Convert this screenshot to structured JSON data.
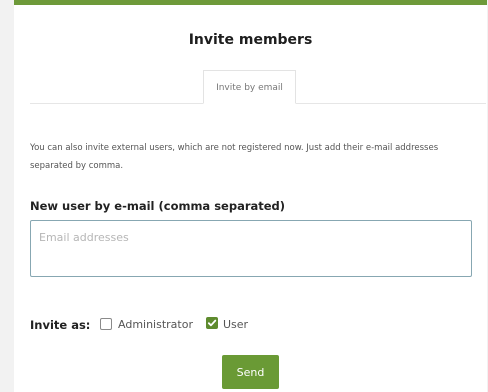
{
  "dialog": {
    "title": "Invite members",
    "tabs": [
      {
        "label": "Invite by email",
        "active": true
      }
    ],
    "info_text": "You can also invite external users, which are not registered now. Just add their e-mail addresses separated by comma.",
    "email_label": "New user by e-mail (comma separated)",
    "email_input": {
      "placeholder": "Email addresses",
      "value": ""
    },
    "invite_as_label": "Invite as:",
    "roles": [
      {
        "label": "Administrator",
        "checked": false
      },
      {
        "label": "User",
        "checked": true
      }
    ],
    "send_label": "Send"
  },
  "colors": {
    "accent": "#6a9a35",
    "top_bar": "#6e9a3a",
    "input_border": "#87a7b2"
  },
  "icons": {
    "checked": "checkmark-icon"
  }
}
